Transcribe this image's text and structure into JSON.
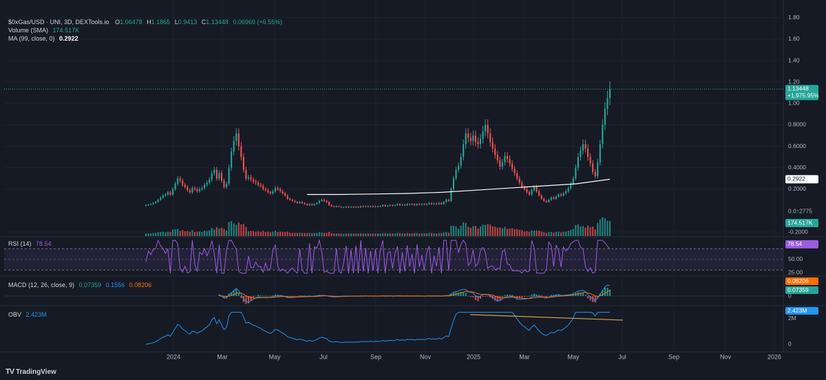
{
  "header": {
    "symbol": "$0xGas/USD · UNI, 3D, DEXTools.io",
    "open_label": "O",
    "open": "1.06478",
    "high_label": "H",
    "high": "1.1865",
    "low_label": "L",
    "low": "0.9413",
    "close_label": "C",
    "close": "1.13448",
    "change": "0.06969 (+6.55%)"
  },
  "volume_legend": {
    "label": "Volume (SMA)",
    "value": "174.517K"
  },
  "ma_legend": {
    "label": "MA (99, close, 0)",
    "value": "0.2922"
  },
  "rsi_legend": {
    "label": "RSI (14)",
    "value": "78.54"
  },
  "macd_legend": {
    "label": "MACD (12, 26, close, 9)",
    "macd": "0.07359",
    "signal": "0.1556",
    "hist": "0.08206"
  },
  "obv_legend": {
    "label": "OBV",
    "value": "2.423M"
  },
  "price_badges": {
    "price": "1.13448",
    "pct": "+1,975.95%",
    "ma": "0.2922",
    "volume": "174.517K",
    "volume_axis": "0.0↑2775"
  },
  "rsi_badge": "78.54",
  "macd_badges": {
    "hist": "0.08206",
    "macd": "0.07359"
  },
  "obv_badge": "2.423M",
  "branding": {
    "logo_mark": "TV",
    "name": "TradingView"
  },
  "colors": {
    "up": "#26a69a",
    "down": "#ef5350",
    "ma": "#ffffff",
    "rsi": "#9c5ce0",
    "macd": "#2196f3",
    "signal": "#ff6d00",
    "obv": "#2196f3",
    "trend": "#d4a24b",
    "bg": "#161a25"
  },
  "chart_data": [
    {
      "type": "candlestick",
      "title": "",
      "x_ticks": [
        "2024",
        "Mar",
        "May",
        "Jul",
        "Sep",
        "Nov",
        "2025",
        "Mar",
        "May",
        "Jul",
        "Sep",
        "Nov",
        "2026"
      ],
      "y_ticks": [
        "1.80",
        "1.60",
        "1.40",
        "1.20",
        "1.00",
        "0.8000",
        "0.6000",
        "0.4000",
        "0.2000",
        "-0.2000"
      ],
      "ylim": [
        -0.2,
        1.85
      ],
      "current_price": 1.13448,
      "grid": true,
      "series_close": [
        0.05,
        0.055,
        0.06,
        0.07,
        0.08,
        0.1,
        0.12,
        0.14,
        0.15,
        0.17,
        0.15,
        0.2,
        0.25,
        0.3,
        0.28,
        0.24,
        0.22,
        0.19,
        0.17,
        0.21,
        0.2,
        0.18,
        0.2,
        0.21,
        0.24,
        0.26,
        0.29,
        0.35,
        0.38,
        0.3,
        0.35,
        0.28,
        0.22,
        0.25,
        0.4,
        0.55,
        0.65,
        0.72,
        0.6,
        0.5,
        0.38,
        0.3,
        0.31,
        0.29,
        0.27,
        0.26,
        0.24,
        0.23,
        0.2,
        0.19,
        0.17,
        0.16,
        0.18,
        0.21,
        0.2,
        0.18,
        0.16,
        0.14,
        0.11,
        0.1,
        0.09,
        0.08,
        0.07,
        0.08,
        0.07,
        0.06,
        0.05,
        0.06,
        0.05,
        0.06,
        0.07,
        0.09,
        0.1,
        0.09,
        0.08,
        0.05,
        0.04,
        0.035,
        0.04,
        0.035,
        0.03,
        0.03,
        0.035,
        0.03,
        0.035,
        0.03,
        0.035,
        0.03,
        0.04,
        0.035,
        0.04,
        0.035,
        0.04,
        0.035,
        0.04,
        0.035,
        0.04,
        0.05,
        0.04,
        0.045,
        0.05,
        0.045,
        0.05,
        0.06,
        0.05,
        0.055,
        0.05,
        0.06,
        0.055,
        0.06,
        0.05,
        0.06,
        0.055,
        0.06,
        0.055,
        0.06,
        0.07,
        0.06,
        0.065,
        0.06,
        0.07,
        0.06,
        0.08,
        0.1,
        0.09,
        0.2,
        0.3,
        0.38,
        0.42,
        0.5,
        0.62,
        0.72,
        0.68,
        0.65,
        0.7,
        0.64,
        0.62,
        0.67,
        0.74,
        0.8,
        0.72,
        0.64,
        0.58,
        0.52,
        0.47,
        0.41,
        0.45,
        0.51,
        0.48,
        0.44,
        0.39,
        0.35,
        0.3,
        0.26,
        0.22,
        0.2,
        0.17,
        0.15,
        0.19,
        0.22,
        0.18,
        0.14,
        0.11,
        0.09,
        0.08,
        0.1,
        0.12,
        0.11,
        0.13,
        0.15,
        0.14,
        0.16,
        0.18,
        0.21,
        0.25,
        0.3,
        0.4,
        0.5,
        0.56,
        0.62,
        0.58,
        0.5,
        0.44,
        0.36,
        0.32,
        0.45,
        0.62,
        0.8,
        0.95,
        1.05,
        1.13448
      ],
      "ma_start_index": 66,
      "ma_end_index": 139,
      "ma_values": [
        0.15,
        0.15,
        0.155,
        0.16,
        0.17,
        0.19,
        0.21,
        0.23,
        0.25,
        0.2922
      ]
    },
    {
      "type": "bar",
      "title": "Volume (SMA)",
      "last_value": "174.517K"
    },
    {
      "type": "line",
      "title": "RSI (14)",
      "y_ticks": [
        "50.00",
        "25.00"
      ],
      "bands": [
        30,
        70
      ],
      "ylim": [
        20,
        90
      ],
      "last_value": 78.54
    },
    {
      "type": "line",
      "title": "MACD (12, 26, close, 9)",
      "y_ticks": [
        "0"
      ],
      "last_macd": 0.07359,
      "last_signal": 0.1556,
      "last_hist": 0.08206
    },
    {
      "type": "line",
      "title": "OBV",
      "y_ticks": [
        "2M",
        "0"
      ],
      "ylim": [
        -0.1,
        2.8
      ],
      "last_value": 2.423,
      "unit": "M"
    }
  ]
}
